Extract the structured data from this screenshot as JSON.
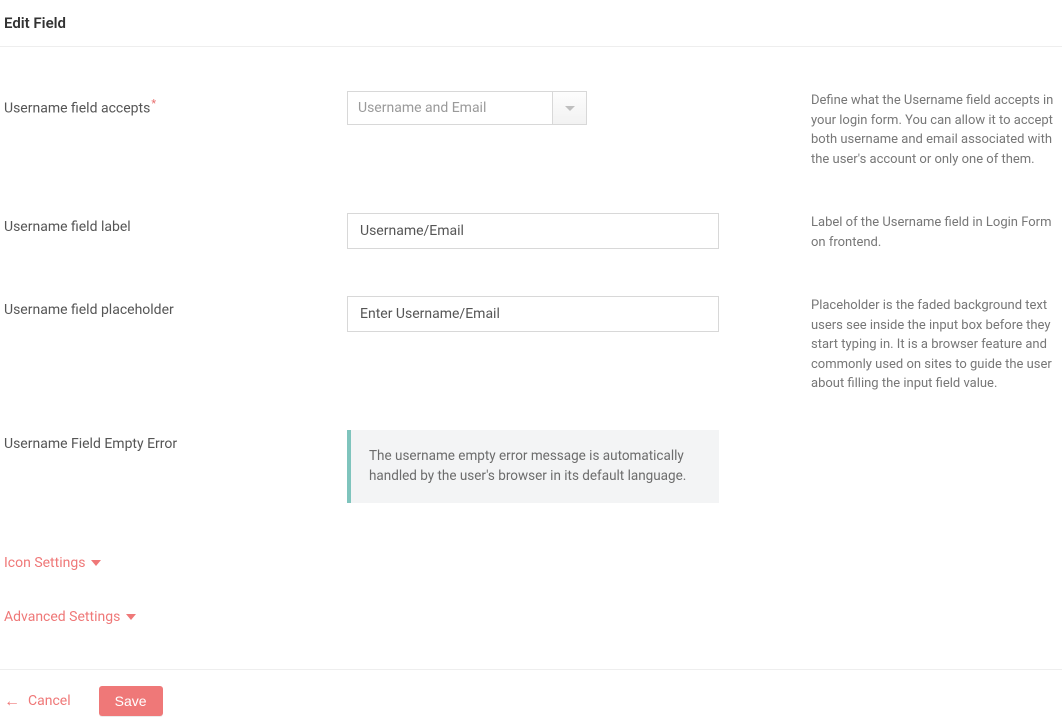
{
  "header": {
    "title": "Edit Field"
  },
  "fields": {
    "accepts": {
      "label": "Username field accepts",
      "required_mark": "*",
      "selected": "Username and Email",
      "help": "Define what the Username field accepts in your login form. You can allow it to accept both username and email associated with the user's account or only one of them."
    },
    "label_field": {
      "label": "Username field label",
      "value": "Username/Email",
      "help": "Label of the Username field in Login Form on frontend."
    },
    "placeholder_field": {
      "label": "Username field placeholder",
      "value": "Enter Username/Email",
      "help": "Placeholder is the faded background text users see inside the input box before they start typing in. It is a browser feature and commonly used on sites to guide the user about filling the input field value."
    },
    "empty_error": {
      "label": "Username Field Empty Error",
      "notice": "The username empty error message is automatically handled by the user's browser in its default language."
    }
  },
  "sections": {
    "icon_settings": "Icon Settings",
    "advanced_settings": "Advanced Settings"
  },
  "footer": {
    "cancel": "Cancel",
    "save": "Save"
  }
}
